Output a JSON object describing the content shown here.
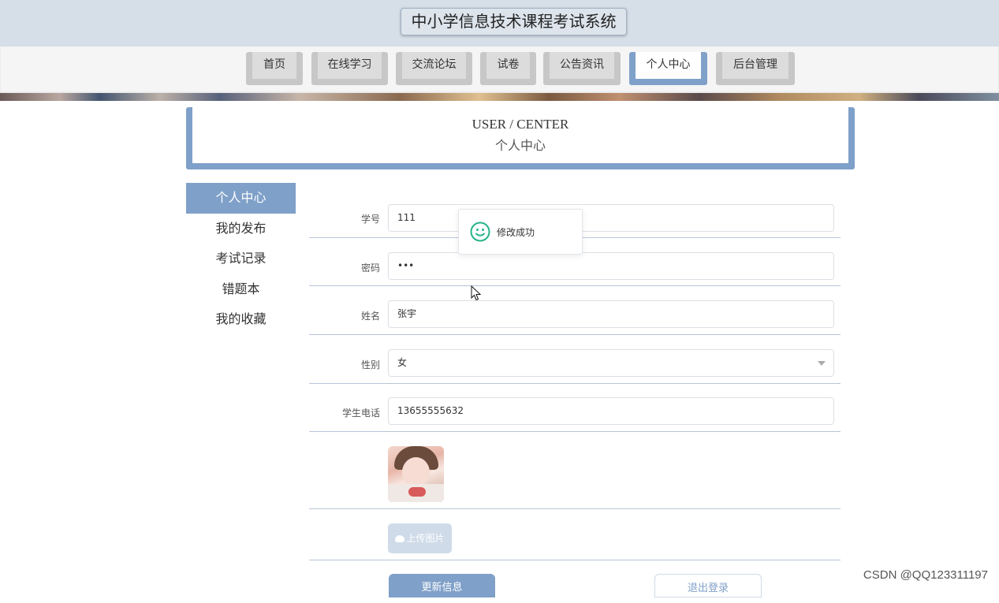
{
  "header": {
    "title": "中小学信息技术课程考试系统"
  },
  "nav": {
    "items": [
      {
        "label": "首页",
        "active": false
      },
      {
        "label": "在线学习",
        "active": false
      },
      {
        "label": "交流论坛",
        "active": false
      },
      {
        "label": "试卷",
        "active": false
      },
      {
        "label": "公告资讯",
        "active": false
      },
      {
        "label": "个人中心",
        "active": true
      },
      {
        "label": "后台管理",
        "active": false
      }
    ]
  },
  "page_header": {
    "en": "USER / CENTER",
    "cn": "个人中心"
  },
  "sidebar": {
    "items": [
      {
        "label": "个人中心",
        "active": true
      },
      {
        "label": "我的发布",
        "active": false
      },
      {
        "label": "考试记录",
        "active": false
      },
      {
        "label": "错题本",
        "active": false
      },
      {
        "label": "我的收藏",
        "active": false
      }
    ]
  },
  "form": {
    "student_id": {
      "label": "学号",
      "value": "111"
    },
    "password": {
      "label": "密码",
      "value": "•••"
    },
    "name": {
      "label": "姓名",
      "value": "张宇"
    },
    "gender": {
      "label": "性别",
      "value": "女"
    },
    "phone": {
      "label": "学生电话",
      "value": "13655555632"
    },
    "upload_label": "上传图片",
    "update_label": "更新信息",
    "logout_label": "退出登录"
  },
  "toast": {
    "message": "修改成功",
    "icon": "smile-icon"
  },
  "colors": {
    "accent": "#7fa0c8",
    "success": "#28b28b",
    "topbar": "#d6dee8"
  },
  "watermark": "CSDN @QQ123311197"
}
